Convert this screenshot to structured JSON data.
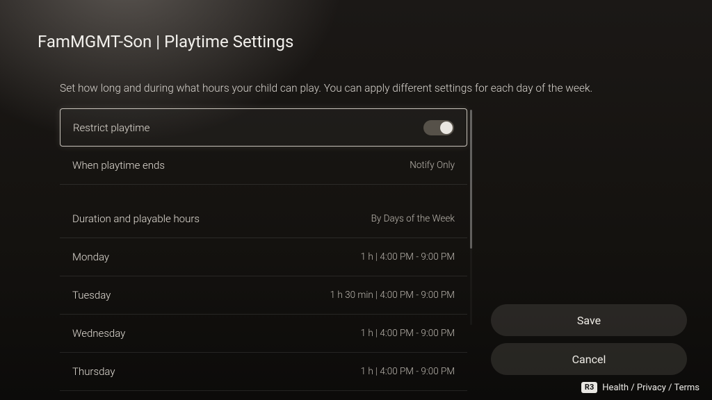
{
  "title": "FamMGMT-Son | Playtime Settings",
  "description": "Set how long and during what hours your child can play. You can apply different settings for each day of the week.",
  "rows": {
    "restrict": {
      "label": "Restrict playtime",
      "toggle_on": true
    },
    "ends": {
      "label": "When playtime ends",
      "value": "Notify Only"
    },
    "duration": {
      "label": "Duration and playable hours",
      "value": "By Days of the Week"
    },
    "monday": {
      "label": "Monday",
      "value": "1 h | 4:00 PM - 9:00 PM"
    },
    "tuesday": {
      "label": "Tuesday",
      "value": "1 h 30 min | 4:00 PM - 9:00 PM"
    },
    "wednesday": {
      "label": "Wednesday",
      "value": "1 h | 4:00 PM - 9:00 PM"
    },
    "thursday": {
      "label": "Thursday",
      "value": "1 h | 4:00 PM - 9:00 PM"
    }
  },
  "buttons": {
    "save": "Save",
    "cancel": "Cancel"
  },
  "footer": {
    "button_hint": "R3",
    "links": "Health / Privacy / Terms"
  }
}
